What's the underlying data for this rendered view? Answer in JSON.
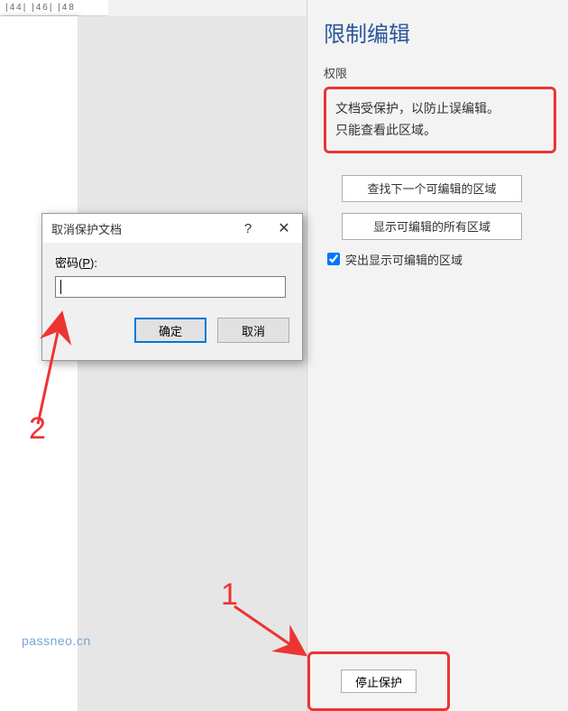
{
  "ruler": {
    "marks": "|44|  |46|  |48"
  },
  "panel": {
    "title": "限制编辑",
    "section_label": "权限",
    "info_line1": "文档受保护，以防止误编辑。",
    "info_line2": "只能查看此区域。",
    "btn_find_next": "查找下一个可编辑的区域",
    "btn_show_all": "显示可编辑的所有区域",
    "checkbox_label": "突出显示可编辑的区域",
    "checkbox_checked": true,
    "stop_protect": "停止保护"
  },
  "dialog": {
    "title": "取消保护文档",
    "help_symbol": "?",
    "close_symbol": "✕",
    "password_label_prefix": "密码(",
    "password_label_key": "P",
    "password_label_suffix": "):",
    "password_value": "",
    "ok": "确定",
    "cancel": "取消"
  },
  "annotations": {
    "num1": "1",
    "num2": "2"
  },
  "watermark": "passneo.cn"
}
